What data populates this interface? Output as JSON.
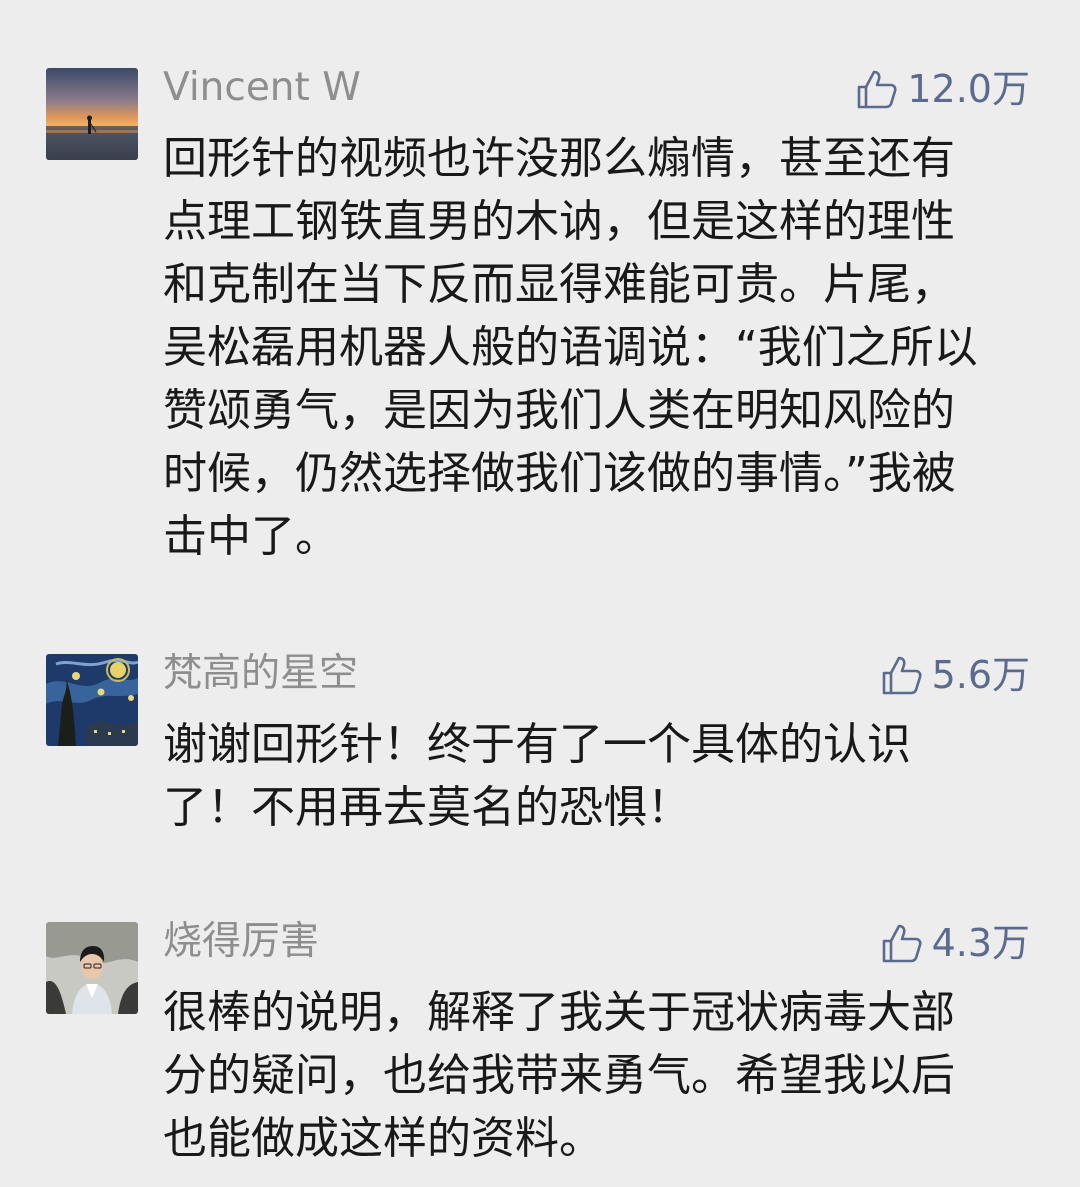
{
  "comments": [
    {
      "author": "Vincent W",
      "likes": "12.0万",
      "lines": [
        "回形针的视频也许没那么煽情，甚至还有",
        "点理工钢铁直男的木讷，但是这样的理性",
        "和克制在当下反而显得难能可贵。片尾，",
        "吴松磊用机器人般的语调说：“我们之所以",
        "赞颂勇气，是因为我们人类在明知风险的",
        "时候，仍然选择做我们该做的事情。”我被",
        "击中了。"
      ]
    },
    {
      "author": "梵高的星空",
      "likes": "5.6万",
      "lines": [
        "谢谢回形针！终于有了一个具体的认识",
        "了！不用再去莫名的恐惧！"
      ]
    },
    {
      "author": "烧得厉害",
      "likes": "4.3万",
      "lines": [
        "很棒的说明，解释了我关于冠状病毒大部",
        "分的疑问，也给我带来勇气。希望我以后",
        "也能做成这样的资料。"
      ]
    }
  ],
  "colors": {
    "background": "#ededed",
    "author": "#8e8e8e",
    "like_accent": "#5b6b8f",
    "body_text": "#191919"
  },
  "icons": {
    "like": "thumbs-up-icon"
  }
}
